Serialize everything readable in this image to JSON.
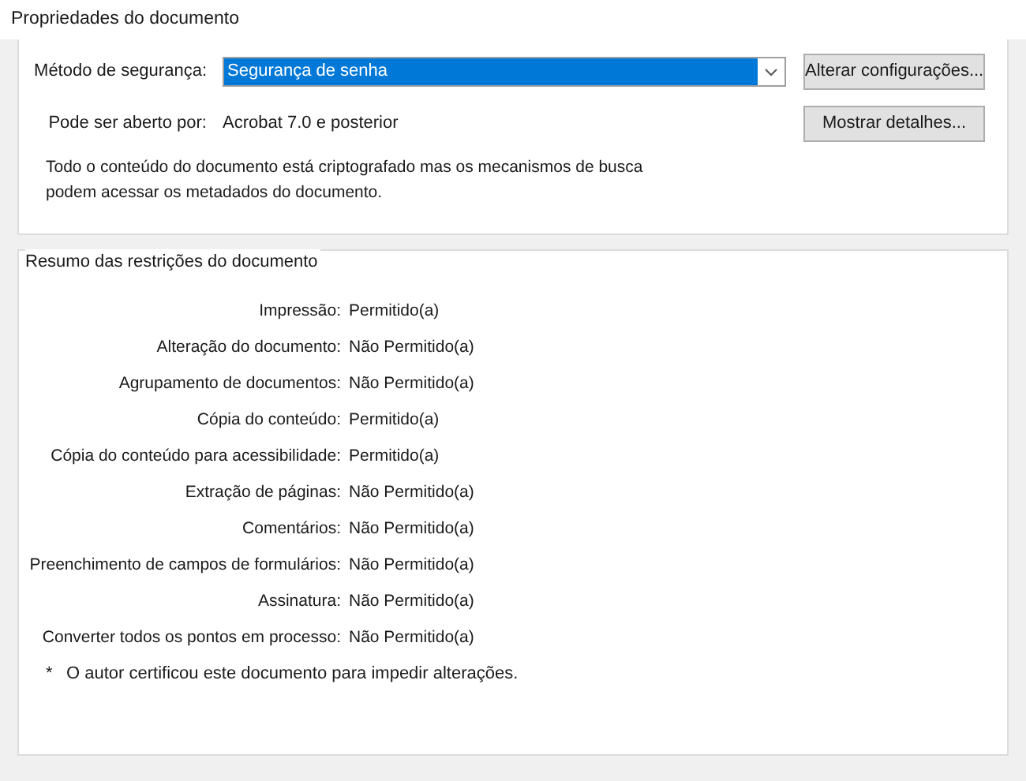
{
  "window": {
    "title": "Propriedades do documento"
  },
  "security": {
    "method_label": "Método de segurança:",
    "method_value": "Segurança de senha",
    "change_button": "Alterar configurações...",
    "open_label": "Pode ser aberto por:",
    "open_value": "Acrobat 7.0 e posterior",
    "details_button": "Mostrar detalhes...",
    "note": "Todo o conteúdo do documento está criptografado mas os mecanismos de busca podem acessar os metadados do documento."
  },
  "restrictions": {
    "title": "Resumo das restrições do documento",
    "rows": [
      {
        "label": "Impressão:",
        "value": "Permitido(a)"
      },
      {
        "label": "Alteração do documento:",
        "value": "Não Permitido(a)"
      },
      {
        "label": "Agrupamento de documentos:",
        "value": "Não Permitido(a)"
      },
      {
        "label": "Cópia do conteúdo:",
        "value": "Permitido(a)"
      },
      {
        "label": "Cópia do conteúdo para acessibilidade:",
        "value": "Permitido(a)"
      },
      {
        "label": "Extração de páginas:",
        "value": "Não Permitido(a)"
      },
      {
        "label": "Comentários:",
        "value": "Não Permitido(a)"
      },
      {
        "label": "Preenchimento de campos de formulários:",
        "value": "Não Permitido(a)"
      },
      {
        "label": "Assinatura:",
        "value": "Não Permitido(a)"
      },
      {
        "label": "Converter todos os pontos em processo:",
        "value": "Não Permitido(a)"
      }
    ],
    "footnote_mark": "*",
    "footnote": "O autor certificou este documento para impedir alterações."
  }
}
